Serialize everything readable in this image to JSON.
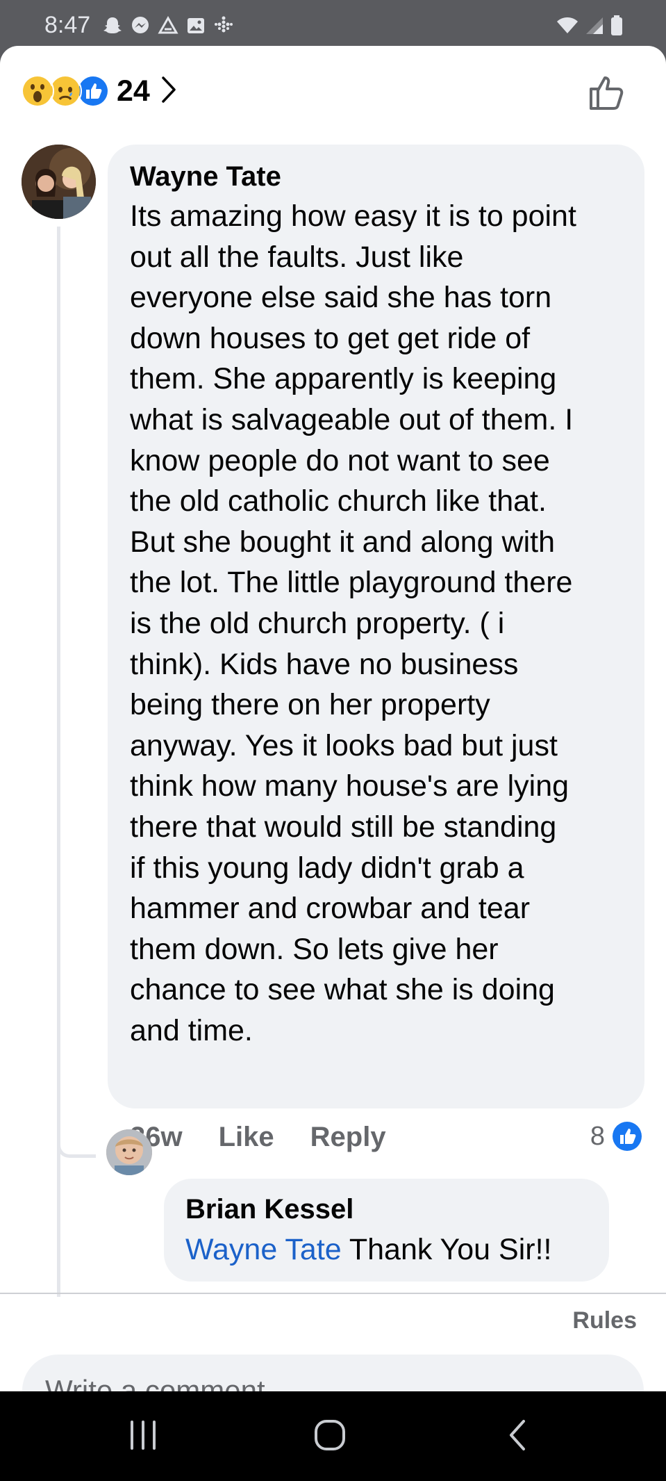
{
  "status_bar": {
    "time": "8:47",
    "left_icons": [
      "snapchat-icon",
      "messenger-icon",
      "drive-icon",
      "gallery-icon",
      "dots-grid-icon"
    ],
    "right_icons": [
      "wifi-icon",
      "signal-icon",
      "battery-icon"
    ]
  },
  "reactions": {
    "emojis": [
      "wow-reaction",
      "sad-reaction",
      "like-reaction"
    ],
    "count": "24",
    "colors": {
      "like_blue": "#1877f2",
      "emoji_yellow": "#f7c437"
    }
  },
  "comment": {
    "author": "Wayne Tate",
    "text": "Its amazing how easy it is to point\nout all the faults. Just like\neveryone else said she has torn\ndown houses to get get ride of\nthem. She apparently is keeping\nwhat is salvageable out of them. I\nknow people do not want to see\nthe old catholic church like that.\nBut she bought it and along with\nthe lot. The little playground there\nis the old church property. ( i\nthink). Kids have no business\nbeing there on her property\nanyway. Yes it looks bad but just\nthink how many house's are lying\nthere that would still be standing\nif this young lady didn't grab a\nhammer and crowbar and tear\nthem down. So lets give her\nchance to see what she is doing\nand time.",
    "time": "36w",
    "like_label": "Like",
    "reply_label": "Reply",
    "like_count": "8"
  },
  "reply": {
    "author": "Brian Kessel",
    "mention": "Wayne Tate",
    "text": "Thank You Sir!!"
  },
  "footer": {
    "rules_label": "Rules",
    "composer_placeholder": "Write a comment…"
  },
  "nav": [
    "recent-apps-icon",
    "home-icon",
    "back-icon"
  ]
}
